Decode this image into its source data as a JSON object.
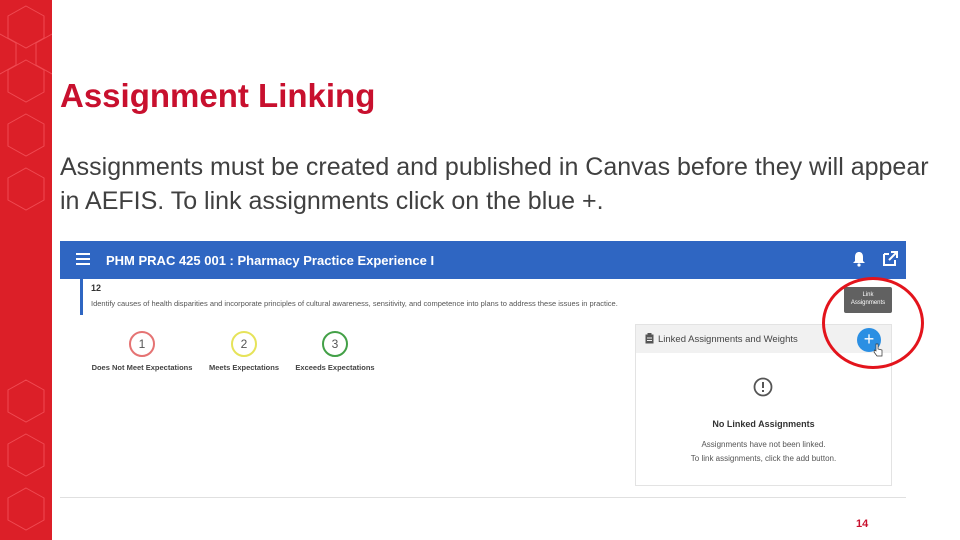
{
  "slide": {
    "title": "Assignment Linking",
    "body": "Assignments must be created and published in Canvas before they will appear in AEFIS. To link assignments click on the blue +.",
    "page_number": "14",
    "accent_color": "#dc1f28",
    "highlight_color": "#e3141c"
  },
  "app": {
    "header": {
      "title": "PHM PRAC 425 001 : Pharmacy Practice Experience I",
      "bar_color": "#2f66c2",
      "icons": [
        "menu-icon",
        "bell-icon",
        "external-link-icon"
      ]
    },
    "outcome": {
      "number": "12",
      "text": "Identify causes of health disparities and incorporate principles of cultural awareness, sensitivity, and competence into plans to address these issues in practice."
    },
    "ratings": [
      {
        "value": "1",
        "label": "Does Not Meet Expectations",
        "color": "#e57373"
      },
      {
        "value": "2",
        "label": "Meets Expectations",
        "color": "#e6e35a"
      },
      {
        "value": "3",
        "label": "Exceeds Expectations",
        "color": "#43a047"
      }
    ],
    "panel": {
      "title": "Linked Assignments and Weights",
      "add_button": "+",
      "tooltip_line1": "Link",
      "tooltip_line2": "Assignments",
      "empty_title": "No Linked Assignments",
      "empty_line1": "Assignments have not been linked.",
      "empty_line2": "To link assignments, click the add button."
    }
  }
}
